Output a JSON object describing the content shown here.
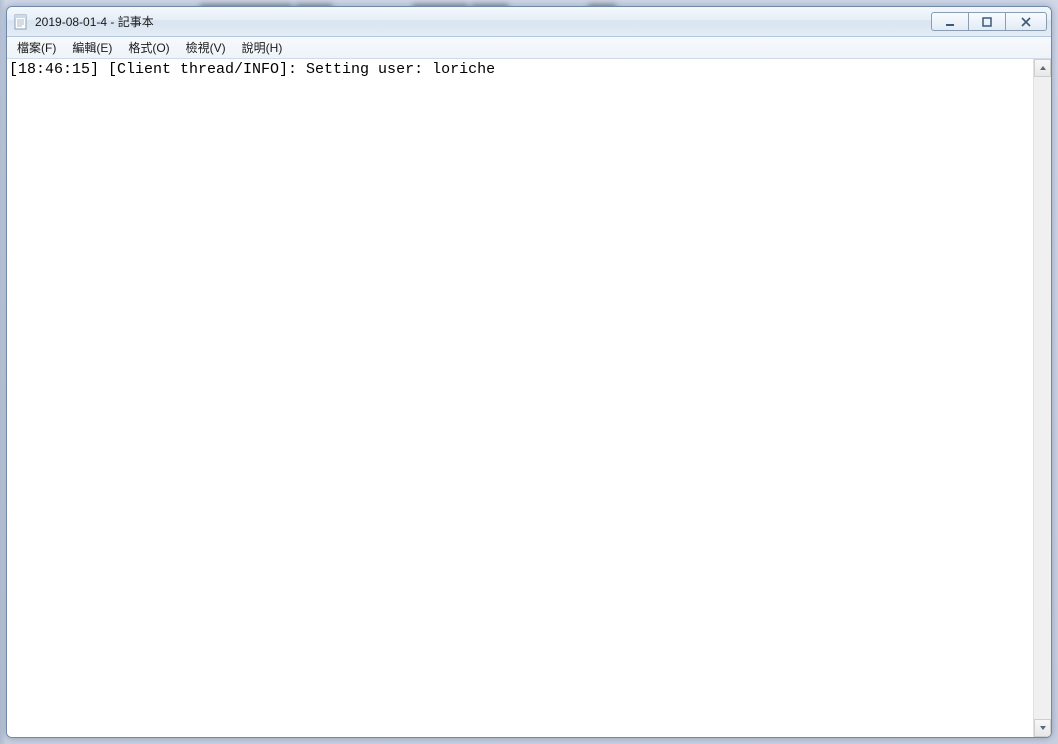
{
  "window": {
    "title": "2019-08-01-4 - 記事本"
  },
  "menu": {
    "file": "檔案(F)",
    "edit": "編輯(E)",
    "format": "格式(O)",
    "view": "檢視(V)",
    "help": "說明(H)"
  },
  "content": {
    "text": "[18:46:15] [Client thread/INFO]: Setting user: loriche"
  }
}
